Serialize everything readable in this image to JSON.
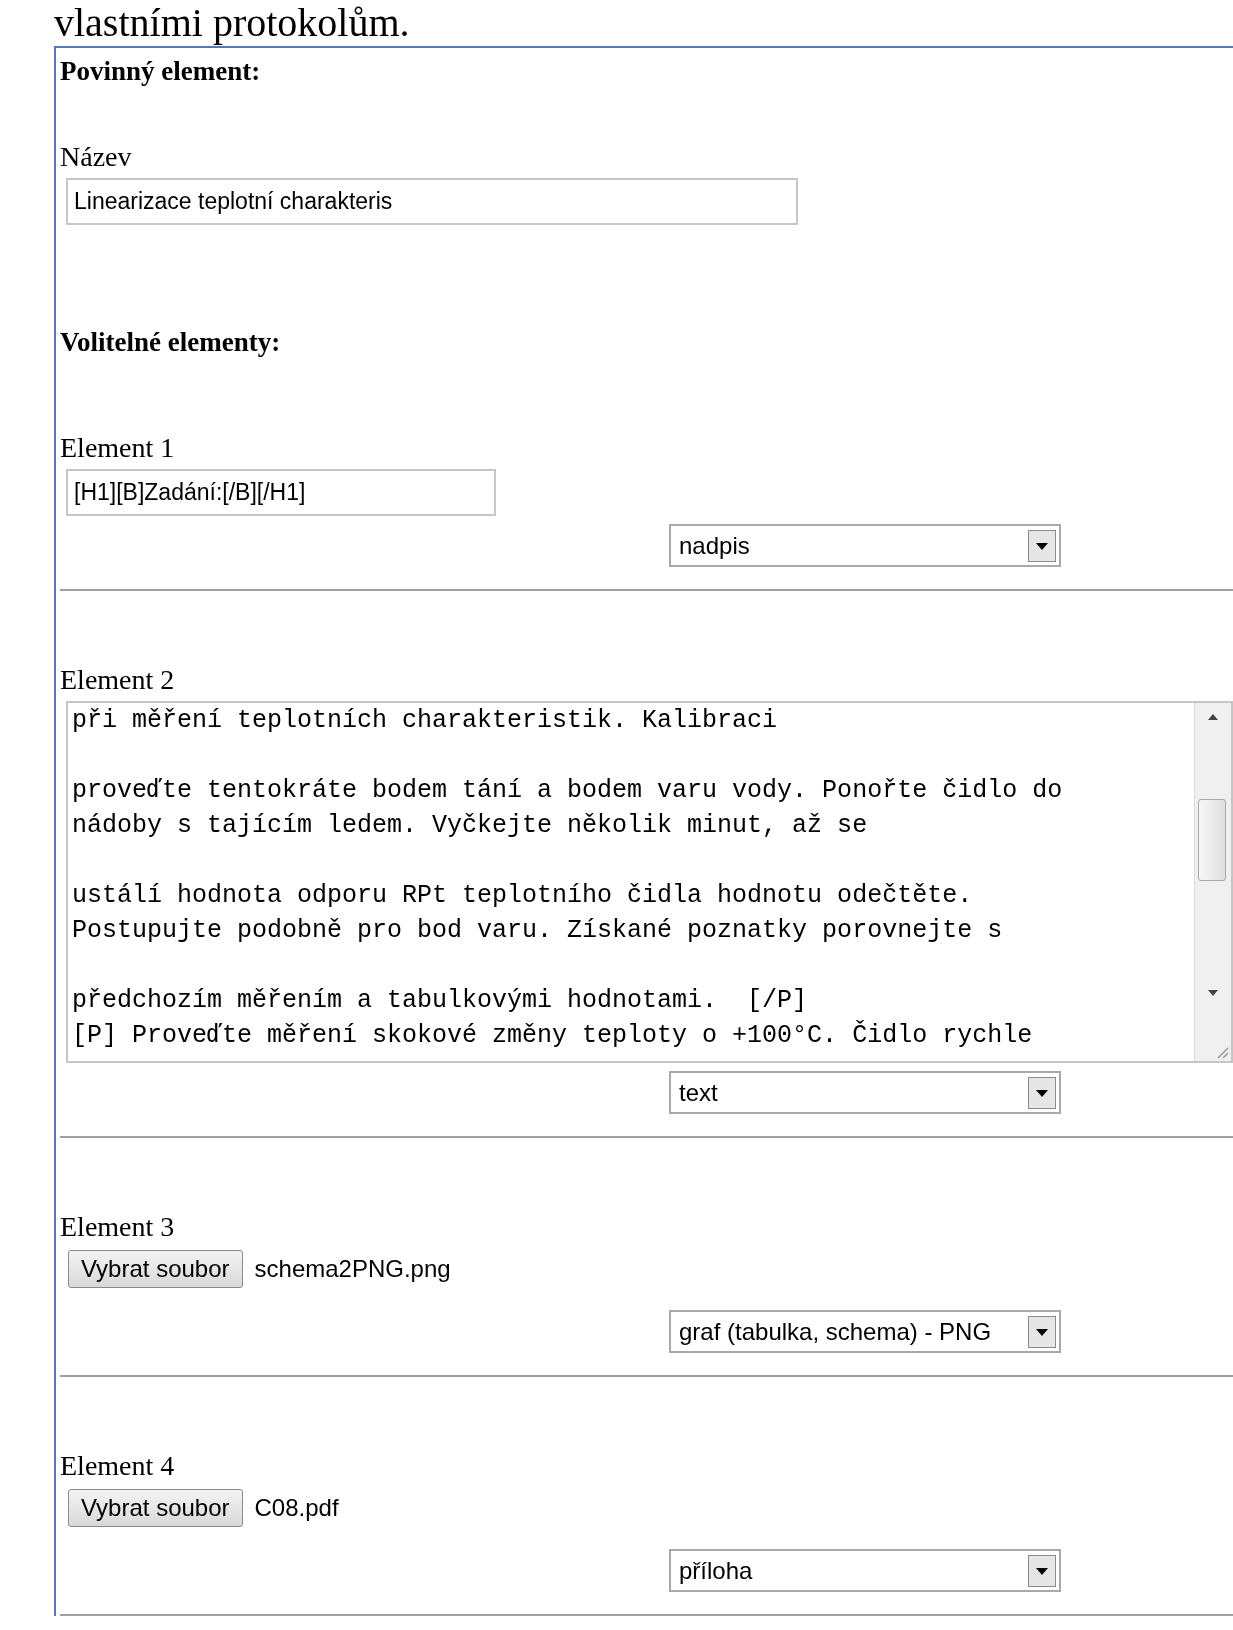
{
  "page_heading": "vlastními protokolům.",
  "required": {
    "heading": "Povinný element:",
    "label": "Název",
    "value": "Linearizace teplotní charakteris"
  },
  "optional": {
    "heading": "Volitelné elementy:",
    "elements": [
      {
        "kind": "text",
        "label": "Element 1",
        "value": "[H1][B]Zadání:[/B][/H1]",
        "select": "nadpis"
      },
      {
        "kind": "textarea",
        "label": "Element 2",
        "value": "při měření teplotních charakteristik. Kalibraci\n\nproveďte tentokráte bodem tání a bodem varu vody. Ponořte čidlo do\nnádoby s tajícím ledem. Vyčkejte několik minut, až se\n\nustálí hodnota odporu RPt teplotního čidla hodnotu odečtěte.\nPostupujte podobně pro bod varu. Získané poznatky porovnejte s\n\npředchozím měřením a tabulkovými hodnotami.  [/P]\n[P] Proveďte měření skokové změny teploty o +100°C. Čidlo rychle",
        "select": "text"
      },
      {
        "kind": "file",
        "label": "Element 3",
        "button": "Vybrat soubor",
        "file_name": "schema2PNG.png",
        "select": "graf (tabulka, schema) - PNG"
      },
      {
        "kind": "file",
        "label": "Element 4",
        "button": "Vybrat soubor",
        "file_name": "C08.pdf",
        "select": "příloha"
      }
    ]
  }
}
